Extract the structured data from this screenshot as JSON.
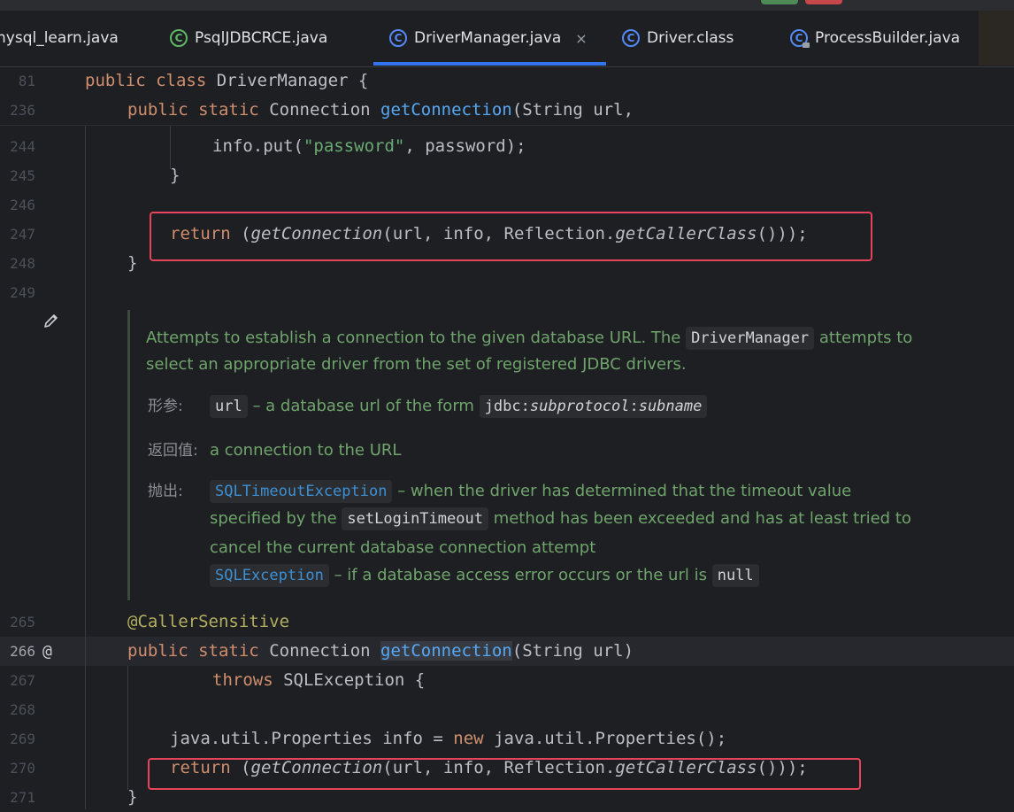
{
  "tabs": [
    {
      "label": "nysql_learn.java",
      "icon": "none"
    },
    {
      "label": "PsqlJDBCRCE.java",
      "icon": "java-class-run-icon"
    },
    {
      "label": "DriverManager.java",
      "icon": "java-class-icon",
      "active": true,
      "close": "×"
    },
    {
      "label": "Driver.class",
      "icon": "java-class-icon"
    },
    {
      "label": "ProcessBuilder.java",
      "icon": "java-class-locked-icon"
    }
  ],
  "code": {
    "lines": [
      {
        "n": "81"
      },
      {
        "n": "236"
      },
      {
        "n": "244"
      },
      {
        "n": "245"
      },
      {
        "n": "246"
      },
      {
        "n": "247"
      },
      {
        "n": "248"
      },
      {
        "n": "249"
      },
      {
        "n": "265"
      },
      {
        "n": "266"
      },
      {
        "n": "267"
      },
      {
        "n": "268"
      },
      {
        "n": "269"
      },
      {
        "n": "270"
      },
      {
        "n": "271"
      }
    ],
    "t": {
      "public": "public",
      "class": "class",
      "DriverManager": "DriverManager",
      "brace_open": " {",
      "static": "static",
      "Connection": "Connection",
      "getConnection": "getConnection",
      "string_url": "(String url,",
      "info_put": "info.put(",
      "password_str": "\"password\"",
      "password_rest": ", password);",
      "brace_close": "}",
      "return": "return",
      "paren": " (",
      "args": "(url, info, Reflection.",
      "getCallerClass": "getCallerClass",
      "tail": "()));",
      "annotation": "@CallerSensitive",
      "string_url2": "(String url)",
      "throws": "throws",
      "sqlexc": " SQLException {",
      "props_a": "java.util.Properties info = ",
      "new": "new",
      "props_b": " java.util.Properties();"
    }
  },
  "doc": {
    "desc_1a": "Attempts to establish a connection to the given database URL. The",
    "desc_chip": "DriverManager",
    "desc_1b": "attempts to",
    "desc_2": "select an appropriate driver from the set of registered JDBC drivers.",
    "params_label": "形参:",
    "param_chip": "url",
    "param_text": "– a database url of the form",
    "param_form_a": "jdbc:",
    "param_form_b": "subprotocol",
    "param_form_c": ":",
    "param_form_d": "subname",
    "returns_label": "返回值:",
    "returns_text": "a connection to the URL",
    "throws_label": "抛出:",
    "ex1": "SQLTimeoutException",
    "ex1_text": "– when the driver has determined that the timeout value",
    "ex1_l2a": "specified by the",
    "ex1_chip": "setLoginTimeout",
    "ex1_l2b": "method has been exceeded and has at least tried to",
    "ex1_l3": "cancel the current database connection attempt",
    "ex2": "SQLException",
    "ex2_text": "– if a database access error occurs or the url is",
    "ex2_chip": "null"
  },
  "gutter_icons": {
    "edit": "pencil-icon",
    "override": "at-icon",
    "at_glyph": "@"
  }
}
